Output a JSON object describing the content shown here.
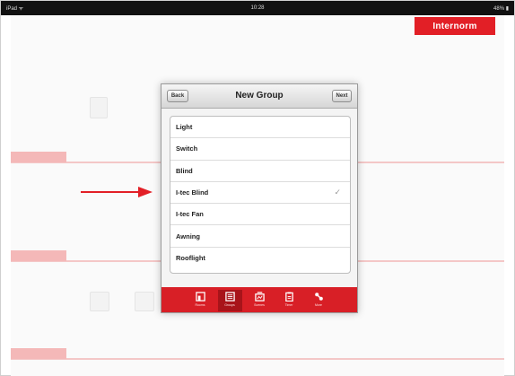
{
  "status_bar": {
    "left": "iPad ᯤ",
    "time": "10:28",
    "right": "48% ▮"
  },
  "brand": {
    "logo_text": "Internorm",
    "accent": "#e21f26"
  },
  "modal": {
    "title": "New Group",
    "back_label": "Back",
    "next_label": "Next",
    "items": [
      {
        "label": "Light",
        "checked": false
      },
      {
        "label": "Switch",
        "checked": false
      },
      {
        "label": "Blind",
        "checked": false
      },
      {
        "label": "I-tec Blind",
        "checked": true
      },
      {
        "label": "I-tec Fan",
        "checked": false
      },
      {
        "label": "Awning",
        "checked": false
      },
      {
        "label": "Rooflight",
        "checked": false
      }
    ],
    "checkmark": "✓"
  },
  "tabbar": {
    "tabs": [
      {
        "label": "Rooms",
        "icon": "rooms-icon",
        "active": false
      },
      {
        "label": "Groups",
        "icon": "groups-icon",
        "active": true
      },
      {
        "label": "Scenes",
        "icon": "scenes-icon",
        "active": false
      },
      {
        "label": "Timer",
        "icon": "timer-icon",
        "active": false
      },
      {
        "label": "More",
        "icon": "more-icon",
        "active": false
      }
    ]
  },
  "annotation": {
    "color": "#e21f26"
  }
}
